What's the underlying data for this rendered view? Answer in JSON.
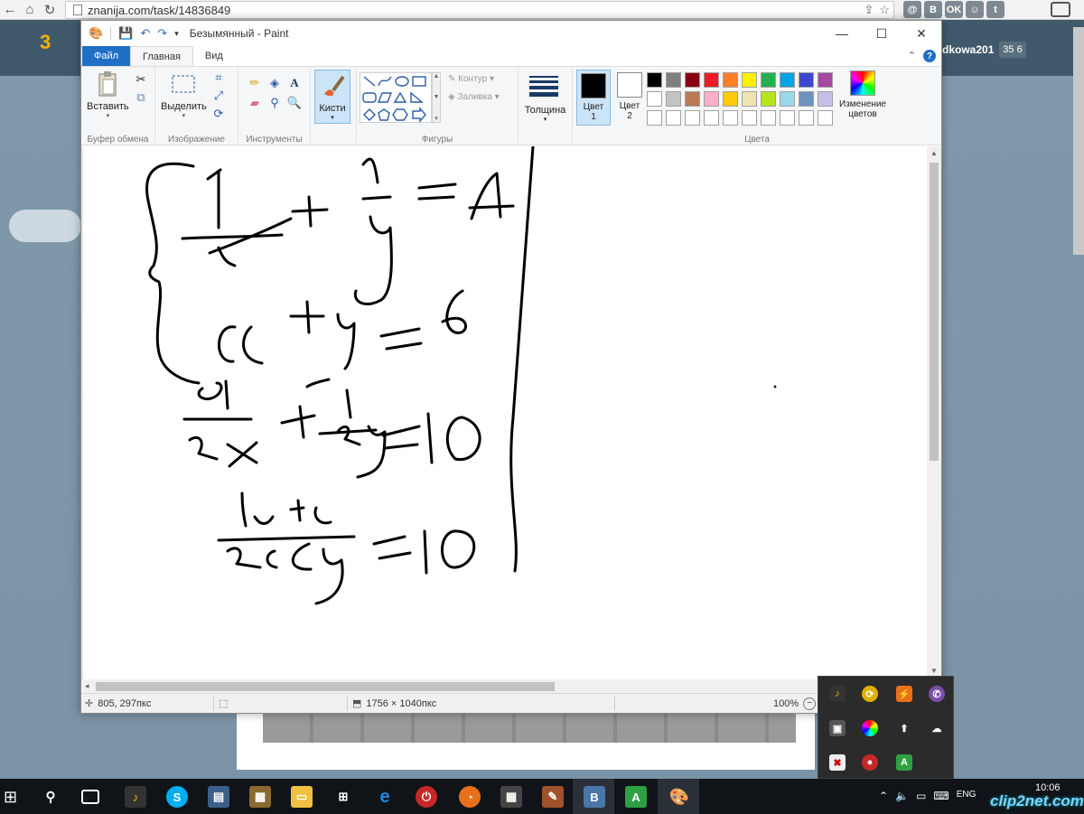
{
  "browser": {
    "url": "znanija.com/task/14836849",
    "ext_icons": [
      "@",
      "B",
      "OK",
      "☺",
      "t"
    ]
  },
  "site": {
    "logo": "3",
    "username": "dkowa201",
    "points": "35 6"
  },
  "paint": {
    "window_title": "Безымянный - Paint",
    "tabs": {
      "file": "Файл",
      "home": "Главная",
      "view": "Вид"
    },
    "groups": {
      "clipboard": "Буфер обмена",
      "image": "Изображение",
      "tools": "Инструменты",
      "shapes": "Фигуры",
      "colors": "Цвета"
    },
    "buttons": {
      "paste": "Вставить",
      "select": "Выделить",
      "brushes": "Кисти",
      "outline": "Контур",
      "fill": "Заливка",
      "thickness": "Толщина",
      "color1_line1": "Цвет",
      "color1_line2": "1",
      "color2_line1": "Цвет",
      "color2_line2": "2",
      "edit_colors_line1": "Изменение",
      "edit_colors_line2": "цветов"
    },
    "palette_row1": [
      "#000000",
      "#7f7f7f",
      "#880015",
      "#ed1c24",
      "#ff7f27",
      "#fff200",
      "#22b14c",
      "#00a2e8",
      "#3f48cc",
      "#a349a4"
    ],
    "palette_row2": [
      "#ffffff",
      "#c3c3c3",
      "#b97a57",
      "#ffaec9",
      "#ffc90e",
      "#efe4b0",
      "#b5e61d",
      "#99d9ea",
      "#7092be",
      "#c8bfe7"
    ],
    "color1": "#000000",
    "color2": "#ffffff",
    "status": {
      "cursor_pos": "805, 297пкс",
      "image_size": "1756 × 1040пкс",
      "zoom": "100%"
    }
  },
  "taskbar": {
    "lang": "ENG",
    "time": "10:06",
    "watermark": "clip2net.com"
  }
}
